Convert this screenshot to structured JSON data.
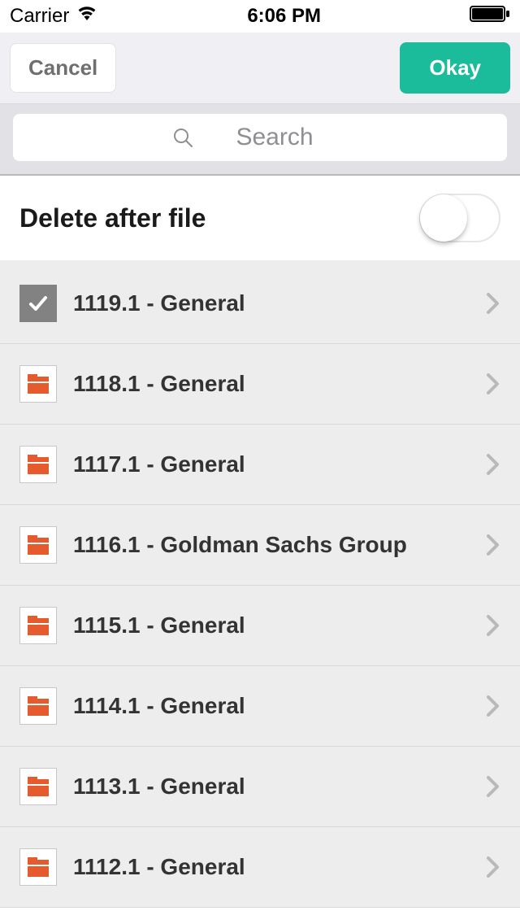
{
  "status": {
    "carrier": "Carrier",
    "time": "6:06 PM"
  },
  "nav": {
    "cancel_label": "Cancel",
    "okay_label": "Okay"
  },
  "search": {
    "placeholder": "Search"
  },
  "option": {
    "delete_after_file_label": "Delete after file",
    "delete_after_file_on": false
  },
  "items": [
    {
      "label": "1119.1 - General",
      "checked": true
    },
    {
      "label": "1118.1 - General",
      "checked": false
    },
    {
      "label": "1117.1 - General",
      "checked": false
    },
    {
      "label": "1116.1 - Goldman Sachs Group",
      "checked": false
    },
    {
      "label": "1115.1 - General",
      "checked": false
    },
    {
      "label": "1114.1 - General",
      "checked": false
    },
    {
      "label": "1113.1 - General",
      "checked": false
    },
    {
      "label": "1112.1 - General",
      "checked": false
    }
  ],
  "colors": {
    "accent": "#1abc9c",
    "folder": "#e55b2e",
    "checked_bg": "#828282"
  }
}
